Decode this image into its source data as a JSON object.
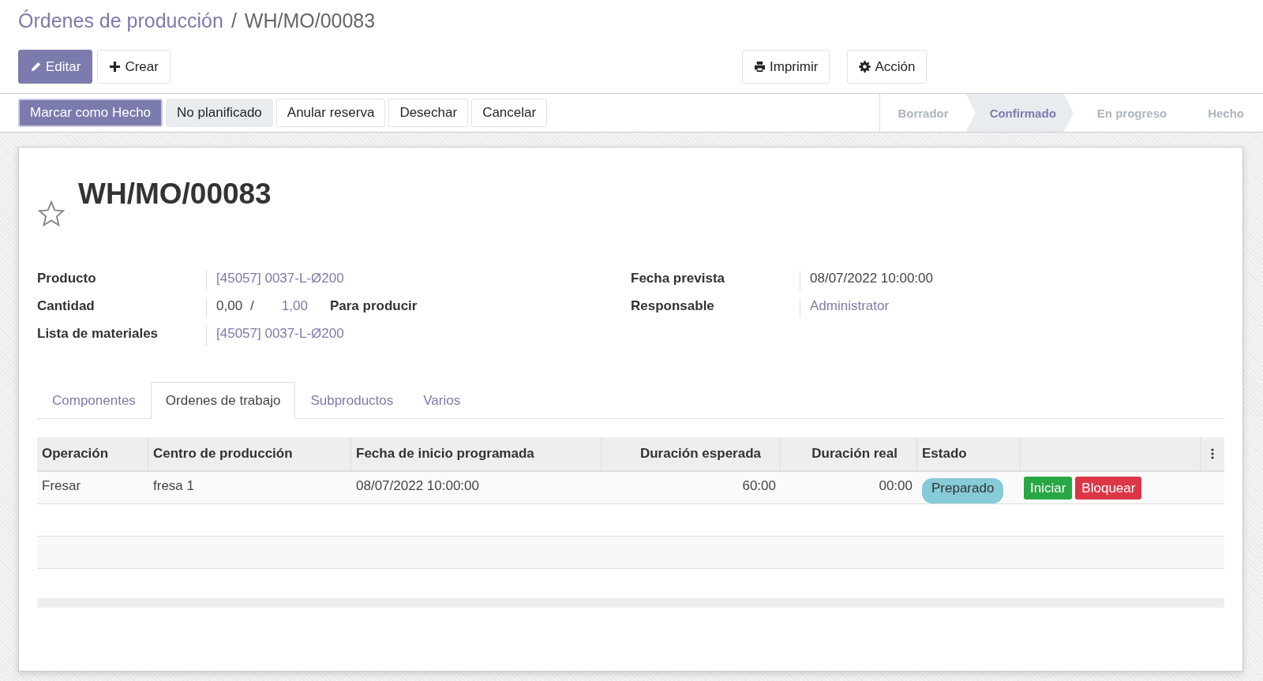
{
  "breadcrumb": {
    "parent": "Órdenes de producción",
    "separator": "/",
    "current": "WH/MO/00083"
  },
  "main_buttons": [
    {
      "label": "Editar",
      "kind": "primary"
    },
    {
      "label": "Crear",
      "kind": "default"
    }
  ],
  "tool_buttons": [
    {
      "label": "Imprimir"
    },
    {
      "label": "Acción"
    }
  ],
  "action_buttons": [
    {
      "label": "Marcar como Hecho",
      "kind": "primary"
    },
    {
      "label": "No planificado",
      "kind": "muted"
    },
    {
      "label": "Anular reserva",
      "kind": "default"
    },
    {
      "label": "Desechar",
      "kind": "default"
    },
    {
      "label": "Cancelar",
      "kind": "default"
    }
  ],
  "stages": [
    {
      "label": "Borrador",
      "selected": false
    },
    {
      "label": "Confirmado",
      "selected": true
    },
    {
      "label": "En progreso",
      "selected": false
    },
    {
      "label": "Hecho",
      "selected": false
    }
  ],
  "record": {
    "favorite": false,
    "name": "WH/MO/00083"
  },
  "left_fields": [
    {
      "label": "Producto",
      "kind": "link",
      "value": "[45057] 0037-L-Ø200"
    },
    {
      "label": "Cantidad",
      "kind": "quantity",
      "produced": "0,00",
      "separator": "/",
      "planned": "1,00",
      "note": "Para producir"
    },
    {
      "label": "Lista de materiales",
      "kind": "link",
      "value": "[45057] 0037-L-Ø200"
    }
  ],
  "right_fields": [
    {
      "label": "Fecha prevista",
      "kind": "text",
      "value": "08/07/2022 10:00:00"
    },
    {
      "label": "Responsable",
      "kind": "link",
      "value": "Administrator"
    }
  ],
  "tabs": [
    {
      "label": "Componentes",
      "selected": false
    },
    {
      "label": "Ordenes de trabajo",
      "selected": true
    },
    {
      "label": "Subproductos",
      "selected": false
    },
    {
      "label": "Varios",
      "selected": false
    }
  ],
  "table": {
    "columns": [
      {
        "label": "Operación"
      },
      {
        "label": "Centro de producción"
      },
      {
        "label": "Fecha de inicio programada"
      },
      {
        "label": "Duración esperada"
      },
      {
        "label": "Duración real"
      },
      {
        "label": "Estado"
      }
    ],
    "rows": [
      {
        "cells": [
          "Fresar",
          "fresa 1",
          "08/07/2022 10:00:00",
          "60:00",
          "00:00"
        ],
        "status": "Preparado",
        "actions": [
          {
            "label": "Iniciar",
            "kind": "start"
          },
          {
            "label": "Bloquear",
            "kind": "block"
          }
        ]
      }
    ]
  }
}
